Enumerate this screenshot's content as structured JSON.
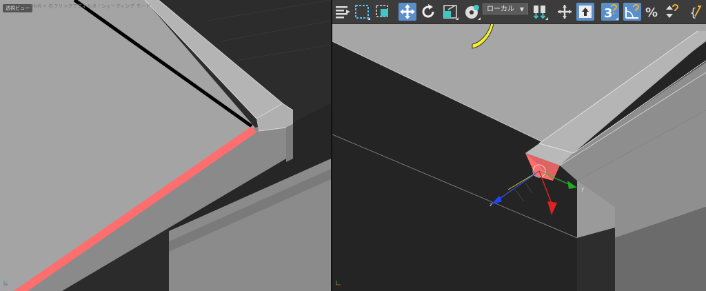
{
  "left_viewport": {
    "button_label": "透視ビュー",
    "hint_text": "Shift + 右クリックでフィルタ / シェーディング モード"
  },
  "toolbar": {
    "coordinate_system": "ローカル",
    "snap_angle_value": "3",
    "accent_color": "#5a8fc9"
  },
  "gizmo": {
    "z_label": "z",
    "y_label": "y"
  },
  "colors": {
    "selected_edge": "#ff6e6e",
    "arrow_annotation": "#f5f02a"
  }
}
